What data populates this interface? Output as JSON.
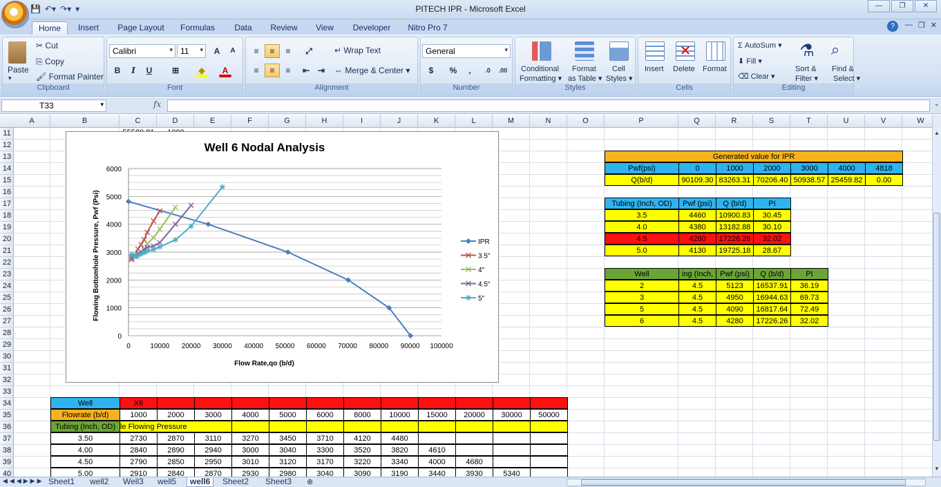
{
  "window": {
    "title": "PITECH IPR - Microsoft Excel"
  },
  "tabs": [
    "Home",
    "Insert",
    "Page Layout",
    "Formulas",
    "Data",
    "Review",
    "View",
    "Developer",
    "Nitro Pro 7"
  ],
  "ribbon": {
    "clipboard": {
      "paste": "Paste",
      "cut": "Cut",
      "copy": "Copy",
      "format_painter": "Format Painter",
      "label": "Clipboard"
    },
    "font": {
      "name": "Calibri",
      "size": "11",
      "bold": "B",
      "italic": "I",
      "underline": "U",
      "label": "Font"
    },
    "alignment": {
      "wrap": "Wrap Text",
      "merge": "Merge & Center",
      "label": "Alignment"
    },
    "number": {
      "format": "General",
      "currency": "$",
      "percent": "%",
      "comma": ",",
      "label": "Number"
    },
    "styles": {
      "conditional": "Conditional",
      "conditional2": "Formatting",
      "format_table": "Format",
      "format_table2": "as Table",
      "cell_styles": "Cell",
      "cell_styles2": "Styles",
      "label": "Styles"
    },
    "cells": {
      "insert": "Insert",
      "delete": "Delete",
      "format": "Format",
      "label": "Cells"
    },
    "editing": {
      "autosum": "AutoSum",
      "fill": "Fill",
      "clear": "Clear",
      "sort": "Sort &",
      "sort2": "Filter",
      "find": "Find &",
      "find2": "Select",
      "label": "Editing"
    }
  },
  "formula_bar": {
    "name_box": "T33",
    "fx": "fx",
    "content": ""
  },
  "columns": [
    "A",
    "B",
    "C",
    "D",
    "E",
    "F",
    "G",
    "H",
    "I",
    "J",
    "K",
    "L",
    "M",
    "N",
    "O",
    "P",
    "Q",
    "R",
    "S",
    "T",
    "U",
    "V",
    "W"
  ],
  "rows": [
    "11",
    "12",
    "13",
    "14",
    "15",
    "16",
    "17",
    "18",
    "19",
    "20",
    "21",
    "22",
    "23",
    "24",
    "25",
    "26",
    "27",
    "28",
    "29",
    "30",
    "31",
    "32",
    "33",
    "34",
    "35",
    "36",
    "37",
    "38",
    "39",
    "40"
  ],
  "partial_cells": {
    "c11": "55580.81",
    "d11": "1000"
  },
  "ipr_table": {
    "title": "Generated value for IPR",
    "pwf_label": "Pwf(psi)",
    "pwf": [
      "0",
      "1000",
      "2000",
      "3000",
      "4000",
      "4818"
    ],
    "q_label": "Q(b/d)",
    "q": [
      "90109.30",
      "83263.31",
      "70206.40",
      "50938.57",
      "25459.82",
      "0.00"
    ]
  },
  "tubing_table": {
    "headers": [
      "Tubing (Inch, OD)",
      "Pwf (psi)",
      "Q (b/d)",
      "PI"
    ],
    "rows": [
      [
        "3.5",
        "4460",
        "10900.83",
        "30.45"
      ],
      [
        "4.0",
        "4380",
        "13182.88",
        "30.10"
      ],
      [
        "4.5",
        "4280",
        "17226.26",
        "32.02"
      ],
      [
        "5.0",
        "4130",
        "19725.18",
        "28.67"
      ]
    ]
  },
  "well_table": {
    "headers": [
      "Well",
      "ing (Inch,",
      "Pwf (psi)",
      "Q (b/d)",
      "PI"
    ],
    "rows": [
      [
        "2",
        "4.5",
        "5123",
        "16537.91",
        "36.19"
      ],
      [
        "3",
        "4.5",
        "4950",
        "16944.63",
        "69.73"
      ],
      [
        "5",
        "4.5",
        "4090",
        "16817.64",
        "72.49"
      ],
      [
        "6",
        "4.5",
        "4280",
        "17226.26",
        "32.02"
      ]
    ]
  },
  "bottom_table": {
    "well_label": "Well",
    "well_value": "X6",
    "flow_label": "Flowrate (b/d)",
    "flows": [
      "1000",
      "2000",
      "3000",
      "4000",
      "5000",
      "6000",
      "8000",
      "10000",
      "15000",
      "20000",
      "30000",
      "50000"
    ],
    "tubing_label": "Tubing (Inch, OD)",
    "pressure_label": "le Flowing Pressure",
    "rows": [
      [
        "3.50",
        "2730",
        "2870",
        "3110",
        "3270",
        "3450",
        "3710",
        "4120",
        "4480",
        "",
        "",
        "",
        ""
      ],
      [
        "4.00",
        "2840",
        "2890",
        "2940",
        "3000",
        "3040",
        "3300",
        "3520",
        "3820",
        "4610",
        "",
        "",
        ""
      ],
      [
        "4.50",
        "2790",
        "2850",
        "2950",
        "3010",
        "3120",
        "3170",
        "3220",
        "3340",
        "4000",
        "4680",
        "",
        ""
      ],
      [
        "5.00",
        "2910",
        "2840",
        "2870",
        "2930",
        "2980",
        "3040",
        "3090",
        "3190",
        "3440",
        "3930",
        "5340",
        ""
      ]
    ]
  },
  "sheets": [
    "Sheet1",
    "well2",
    "Well3",
    "well5",
    "well6",
    "Sheet2",
    "Sheet3"
  ],
  "active_sheet": "well6",
  "chart_data": {
    "type": "scatter",
    "title": "Well 6 Nodal Analysis",
    "xlabel": "Flow Rate,qo  (b/d)",
    "ylabel": "Flowing Bottomhole Pressure, Pwf (Psi)",
    "xlim": [
      0,
      100000
    ],
    "ylim": [
      0,
      6000
    ],
    "xticks": [
      "0",
      "10000",
      "20000",
      "30000",
      "40000",
      "50000",
      "60000",
      "70000",
      "80000",
      "90000",
      "100000"
    ],
    "yticks": [
      "0",
      "1000",
      "2000",
      "3000",
      "4000",
      "5000",
      "6000"
    ],
    "legend_position": "right",
    "grid": true,
    "series": [
      {
        "name": "IPR",
        "color": "#4a7ebb",
        "marker": "diamond",
        "x": [
          0,
          25459.82,
          50938.57,
          70206.4,
          83263.31,
          90109.3
        ],
        "y": [
          4818,
          4000,
          3000,
          2000,
          1000,
          0
        ]
      },
      {
        "name": "3.5\"",
        "color": "#c0504d",
        "marker": "x",
        "x": [
          1000,
          2000,
          3000,
          4000,
          5000,
          6000,
          8000,
          10000
        ],
        "y": [
          2730,
          2870,
          3110,
          3270,
          3450,
          3710,
          4120,
          4480
        ]
      },
      {
        "name": "4\"",
        "color": "#9bbb59",
        "marker": "x",
        "x": [
          1000,
          2000,
          3000,
          4000,
          5000,
          6000,
          8000,
          10000,
          15000
        ],
        "y": [
          2840,
          2890,
          2940,
          3000,
          3040,
          3300,
          3520,
          3820,
          4610
        ]
      },
      {
        "name": "4.5\"",
        "color": "#8064a2",
        "marker": "x",
        "x": [
          1000,
          2000,
          3000,
          4000,
          5000,
          6000,
          8000,
          10000,
          15000,
          20000
        ],
        "y": [
          2790,
          2850,
          2950,
          3010,
          3120,
          3170,
          3220,
          3340,
          4000,
          4680
        ]
      },
      {
        "name": "5\"",
        "color": "#4bacc6",
        "marker": "asterisk",
        "x": [
          1000,
          2000,
          3000,
          4000,
          5000,
          6000,
          8000,
          10000,
          15000,
          20000,
          30000
        ],
        "y": [
          2910,
          2840,
          2870,
          2930,
          2980,
          3040,
          3090,
          3190,
          3440,
          3930,
          5340
        ]
      }
    ]
  }
}
